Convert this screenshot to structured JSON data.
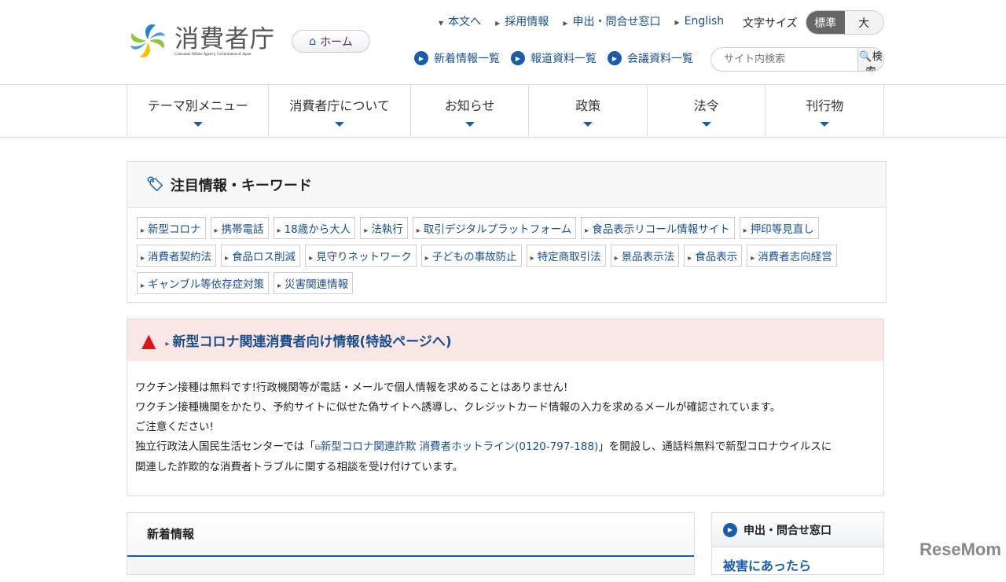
{
  "header": {
    "logo_jp": "消費者庁",
    "logo_en": "Consumer Affairs Agency, Government of Japan",
    "home": "ホーム",
    "top_links": [
      "本文へ",
      "採用情報",
      "申出・問合せ窓口",
      "English"
    ],
    "font_size_label": "文字サイズ",
    "font_sizes": [
      "標準",
      "大"
    ],
    "sub_links": [
      "新着情報一覧",
      "報道資料一覧",
      "会議資料一覧"
    ],
    "search_placeholder": "サイト内検索",
    "search_button": "検索"
  },
  "nav": [
    "テーマ別メニュー",
    "消費者庁について",
    "お知らせ",
    "政策",
    "法令",
    "刊行物"
  ],
  "keywords": {
    "title": "注目情報・キーワード",
    "tags": [
      "新型コロナ",
      "携帯電話",
      "18歳から大人",
      "法執行",
      "取引デジタルプラットフォーム",
      "食品表示リコール情報サイト",
      "押印等見直し",
      "消費者契約法",
      "食品ロス削減",
      "見守りネットワーク",
      "子どもの事故防止",
      "特定商取引法",
      "景品表示法",
      "食品表示",
      "消費者志向経営",
      "ギャンブル等依存症対策",
      "災害関連情報"
    ]
  },
  "alert": {
    "title": "新型コロナ関連消費者向け情報(特設ページへ)",
    "line1": "ワクチン接種は無料です!行政機関等が電話・メールで個人情報を求めることはありません!",
    "line2": "ワクチン接種機関をかたり、予約サイトに似せた偽サイトへ誘導し、クレジットカード情報の入力を求めるメールが確認されています。",
    "line3": "ご注意ください!",
    "line4_pre": "独立行政法人国民生活センターでは「",
    "line4_link": "新型コロナ関連詐欺 消費者ホットライン(0120-797-188)",
    "line4_post": "」を開設し、通話料無料で新型コロナウイルスに",
    "line5": "関連した詐欺的な消費者トラブルに関する相談を受け付けています。"
  },
  "news": {
    "title": "新着情報"
  },
  "side": {
    "title": "申出・問合せ窓口",
    "link": "被害にあったら"
  },
  "watermark": "ReseMom"
}
